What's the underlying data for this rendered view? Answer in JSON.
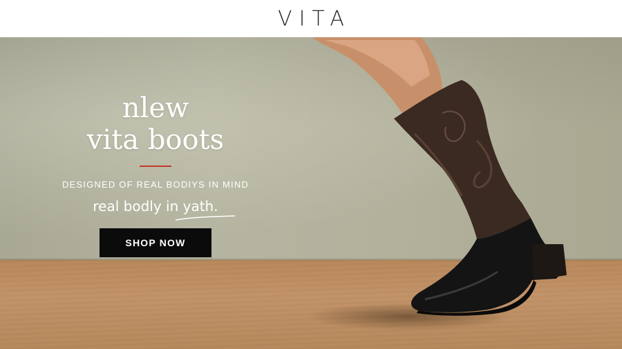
{
  "brand": {
    "logo_text": "VITA"
  },
  "hero": {
    "headline_line1": "nlew",
    "headline_line2": "vita boots",
    "tagline": "DESIGNED OF REAL BODIYS IN MIND",
    "subline": "real bodly in yath.",
    "cta_label": "SHOP NOW"
  },
  "colors": {
    "accent": "#c0392b",
    "button_bg": "#0b0b0b",
    "wall": "#b2b19c",
    "floor": "#c4956a"
  }
}
